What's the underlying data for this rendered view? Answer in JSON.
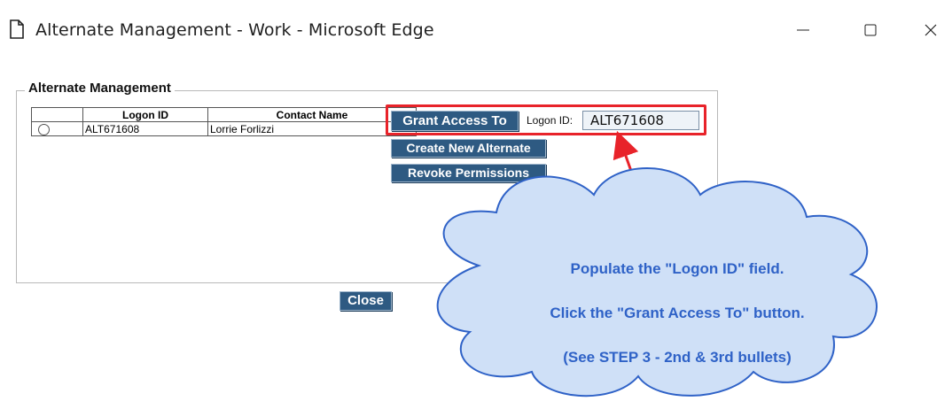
{
  "window": {
    "title": "Alternate Management - Work - Microsoft Edge",
    "icon": "page-icon",
    "controls": [
      "minimize-icon",
      "maximize-icon",
      "close-icon"
    ]
  },
  "group": {
    "legend": "Alternate Management"
  },
  "table": {
    "columns": [
      "",
      "Logon ID",
      "Contact Name"
    ],
    "rows": [
      {
        "logon_id": "ALT671608",
        "contact_name": "Lorrie Forlizzi",
        "selected": false
      }
    ]
  },
  "actions": {
    "grant_label": "Grant Access To",
    "logon_label": "Logon ID:",
    "logon_value": "ALT671608",
    "create_label": "Create New Alternate",
    "revoke_label": "Revoke Permissions",
    "close_label": "Close"
  },
  "annotation": {
    "line1": "Populate the \"Logon ID\" field.",
    "line2": "Click the \"Grant Access To\" button.",
    "line3": "(See STEP 3 - 2nd & 3rd bullets)",
    "highlight_color": "#e8232a",
    "cloud_color": "#cfe0f7",
    "cloud_border": "#2f62c7",
    "text_color": "#2f62c7"
  },
  "colors": {
    "button_bg": "#2e5a82",
    "button_text": "#ffffff"
  }
}
